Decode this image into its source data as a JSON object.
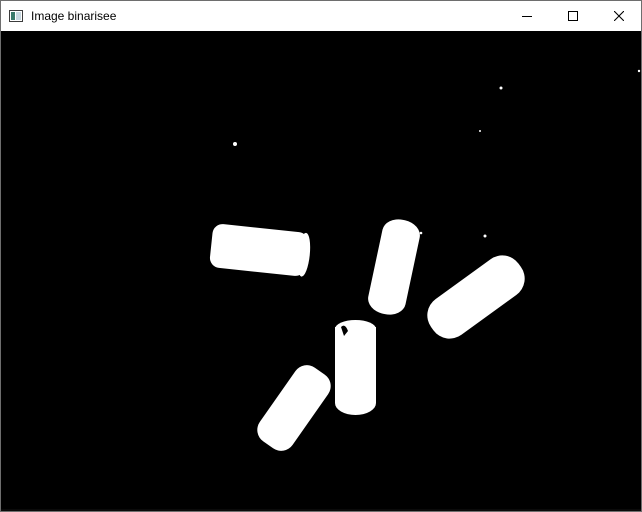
{
  "window": {
    "title": "Image binarisee",
    "icons": {
      "app": "image-window-icon",
      "minimize": "minimize-icon",
      "maximize": "maximize-icon",
      "close": "close-icon"
    }
  },
  "image": {
    "description_type": "binary-threshold",
    "background_color": "#000000",
    "foreground_color": "#ffffff",
    "object_count": 5
  }
}
